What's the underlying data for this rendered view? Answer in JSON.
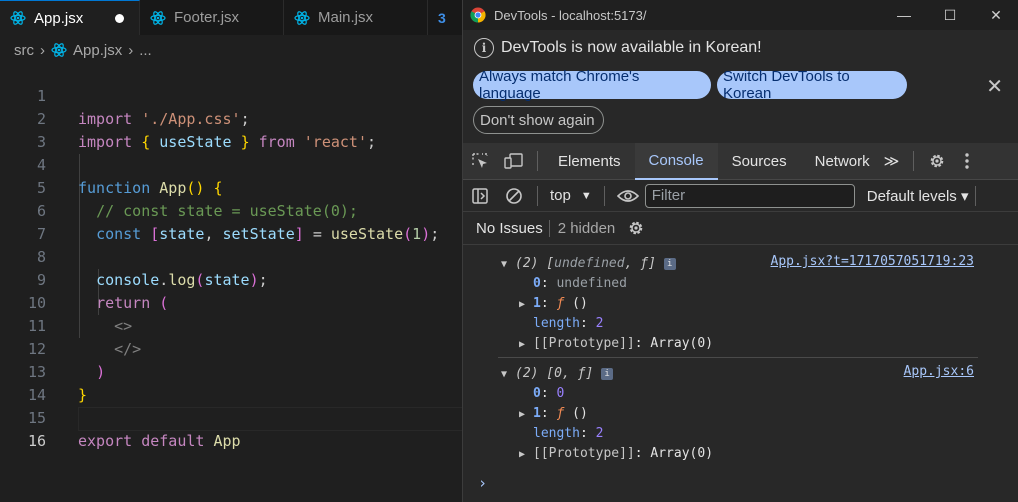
{
  "editor": {
    "tabs": [
      {
        "label": "App.jsx",
        "active": true,
        "modified": true
      },
      {
        "label": "Footer.jsx",
        "active": false
      },
      {
        "label": "Main.jsx",
        "active": false
      },
      {
        "label": "",
        "icon": "css-icon"
      }
    ],
    "breadcrumb": {
      "folder": "src",
      "file": "App.jsx",
      "more": "..."
    },
    "lines": [
      {
        "n": "1"
      },
      {
        "n": "2"
      },
      {
        "n": "3"
      },
      {
        "n": "4"
      },
      {
        "n": "5"
      },
      {
        "n": "6"
      },
      {
        "n": "7"
      },
      {
        "n": "8"
      },
      {
        "n": "9"
      },
      {
        "n": "10"
      },
      {
        "n": "11"
      },
      {
        "n": "12"
      },
      {
        "n": "13"
      },
      {
        "n": "14"
      },
      {
        "n": "15"
      },
      {
        "n": "16"
      }
    ],
    "code": {
      "l1": {
        "kw": "import",
        "str": "'./App.css'",
        "end": ";"
      },
      "l2": {
        "kw": "import",
        "ob": "{",
        "name": "useState",
        "cb": "}",
        "from": "from",
        "str": "'react'",
        "end": ";"
      },
      "l4": {
        "kw": "function",
        "name": "App",
        "parens": "()",
        "brace": "{"
      },
      "l5": {
        "comment": "// const state = useState(0);"
      },
      "l6": {
        "kw": "const",
        "ob": "[",
        "a": "state",
        "comma": ",",
        "b": "setState",
        "cb": "]",
        "eq": "=",
        "fn": "useState",
        "op": "(",
        "num": "1",
        "cp": ")",
        "end": ";"
      },
      "l8": {
        "obj": "console",
        "dot": ".",
        "fn": "log",
        "op": "(",
        "arg": "state",
        "cp": ")",
        "end": ";"
      },
      "l9": {
        "kw": "return",
        "op": "("
      },
      "l10": {
        "tag": "<>"
      },
      "l11": {
        "tag": "</>"
      },
      "l12": {
        "cp": ")"
      },
      "l13": {
        "cb": "}"
      },
      "l15": {
        "kw1": "export",
        "kw2": "default",
        "name": "App"
      }
    }
  },
  "devtools": {
    "window_title": "DevTools - localhost:5173/",
    "win_buttons": {
      "minimize": "—",
      "maximize": "☐",
      "close": "✕"
    },
    "infobar": {
      "message": "DevTools is now available in Korean!",
      "btn_match": "Always match Chrome's language",
      "btn_switch": "Switch DevTools to Korean",
      "btn_dont_show": "Don't show again",
      "close": "✕"
    },
    "tabs": {
      "elements": "Elements",
      "console": "Console",
      "sources": "Sources",
      "network": "Network",
      "more": "≫"
    },
    "console_toolbar": {
      "context": "top",
      "filter_placeholder": "Filter",
      "levels": "Default levels ▾"
    },
    "issues": {
      "label": "No Issues",
      "hidden": "2 hidden"
    },
    "messages": [
      {
        "preview": "(2) [",
        "preview_und": "undefined",
        "preview_rest": ", ƒ]",
        "source": "App.jsx?t=1717057051719:23",
        "k0": "0",
        "v0": "undefined",
        "k1": "1",
        "v1": "ƒ",
        "v1b": "()",
        "klen": "length",
        "vlen": "2",
        "proto": "[[Prototype]]",
        "protov": "Array(0)"
      },
      {
        "preview": "(2) [0, ƒ]",
        "source": "App.jsx:6",
        "k0": "0",
        "v0": "0",
        "k1": "1",
        "v1": "ƒ",
        "v1b": "()",
        "klen": "length",
        "vlen": "2",
        "proto": "[[Prototype]]",
        "protov": "Array(0)"
      }
    ],
    "prompt": "›",
    "colors": {
      "accent": "#a8c7fa",
      "vscode_tab_border": "#0078d4"
    }
  }
}
